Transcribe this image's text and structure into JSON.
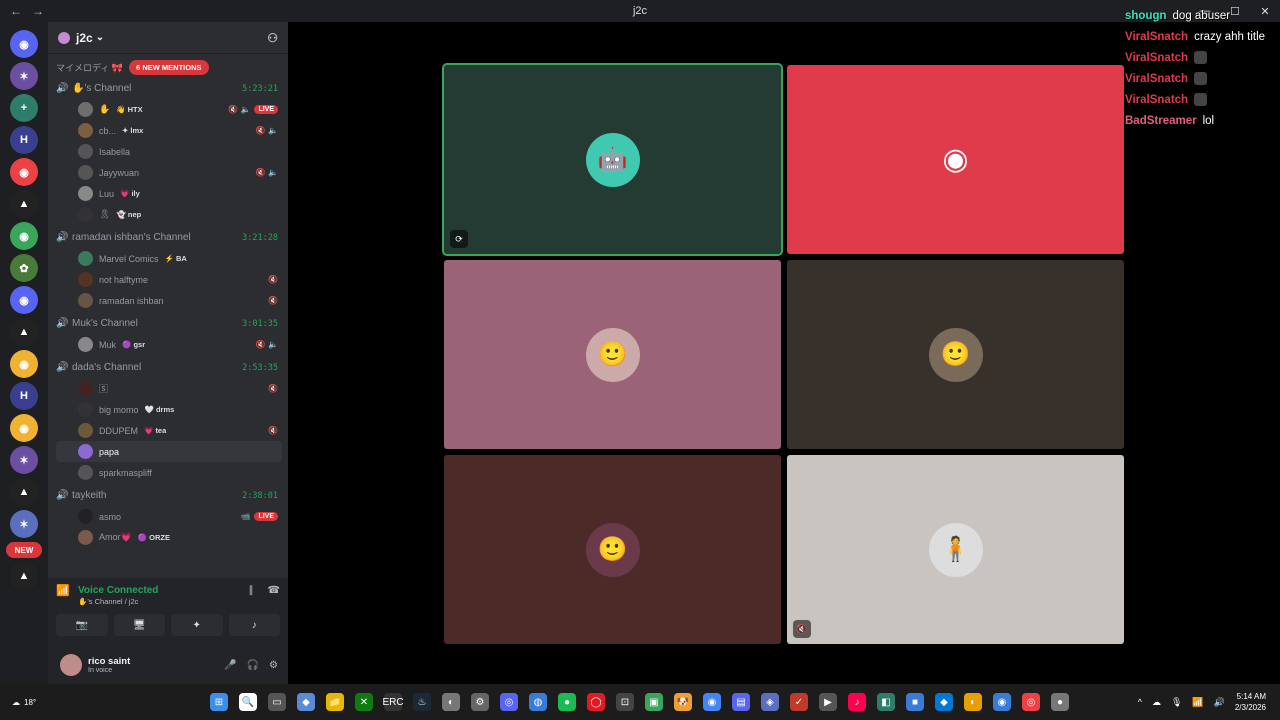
{
  "titlebar": {
    "title": "j2c",
    "back": "←",
    "forward": "→",
    "minimize": "—",
    "maximize": "☐",
    "close": "✕"
  },
  "servers": [
    {
      "label": "◉",
      "badge": "94",
      "color": "#5865f2"
    },
    {
      "label": "✶",
      "badge": "1",
      "color": "#6b4fa0"
    },
    {
      "label": "+",
      "badge": "2",
      "color": "#2e7d6b"
    },
    {
      "label": "H",
      "badge": "1",
      "color": "#3b3f8f"
    },
    {
      "label": "◉",
      "badge": "1",
      "color": "#ed4245"
    },
    {
      "label": "▲",
      "badge": "2",
      "color": "#222"
    },
    {
      "label": "◉",
      "badge": "1",
      "color": "#3ba55c"
    },
    {
      "label": "✿",
      "badge": "1",
      "color": "#4a7a3a"
    },
    {
      "label": "◉",
      "badge": "3",
      "color": "#5865f2"
    },
    {
      "label": "▲",
      "badge": "1",
      "color": "#222"
    },
    {
      "label": "◉",
      "badge": "1",
      "color": "#f0b232"
    },
    {
      "label": "H",
      "badge": "1",
      "color": "#3b3f8f"
    },
    {
      "label": "◉",
      "badge": "1",
      "color": "#f0b232"
    },
    {
      "label": "✶",
      "badge": "1",
      "color": "#6b4fa0"
    },
    {
      "label": "▲",
      "badge": "1",
      "color": "#222"
    },
    {
      "label": "✶",
      "badge": "1",
      "color": "#5b6fbf"
    },
    {
      "label": "▲",
      "badge": "",
      "color": "#222"
    }
  ],
  "new_label": "NEW",
  "guild": {
    "name": "j2c",
    "chevron": "⌄",
    "add_user": "⚇"
  },
  "category": {
    "name": "マイメロディ 🎀",
    "mentions": "6 NEW MENTIONS"
  },
  "channels": [
    {
      "name": "✋'s Channel",
      "time": "5:23:21",
      "users": [
        {
          "name": "✋",
          "tag": "👋 HTX",
          "icons": "🔇 🔈",
          "live": "LIVE",
          "color": "#6e6e6e"
        },
        {
          "name": "cb...",
          "tag": "✦ lmx",
          "icons": "🔇 🔈",
          "live": "",
          "color": "#7a6040"
        },
        {
          "name": "Isabella",
          "tag": "",
          "icons": "",
          "live": "",
          "color": "#555"
        },
        {
          "name": "Jayywuan",
          "tag": "",
          "icons": "🔇 🔈",
          "live": "",
          "color": "#555"
        },
        {
          "name": "Luu",
          "tag": "💗 ily",
          "icons": "",
          "live": "",
          "color": "#888"
        },
        {
          "name": "🎗",
          "tag": "👻 nep",
          "icons": "",
          "live": "",
          "color": "#333"
        }
      ]
    },
    {
      "name": "ramadan ishban's Channel",
      "time": "3:21:28",
      "users": [
        {
          "name": "Marvel Comics",
          "tag": "⚡ BA",
          "icons": "",
          "live": "",
          "color": "#3b7a5a"
        },
        {
          "name": "not halftyme",
          "tag": "",
          "icons": "🔇",
          "live": "",
          "color": "#553322"
        },
        {
          "name": "ramadan ishban",
          "tag": "",
          "icons": "🔇",
          "live": "",
          "color": "#665544"
        }
      ]
    },
    {
      "name": "Muk's Channel",
      "time": "3:01:35",
      "users": [
        {
          "name": "Muk",
          "tag": "🟣 gsr",
          "icons": "🔇 🔈",
          "live": "",
          "color": "#888"
        }
      ]
    },
    {
      "name": "dada's Channel",
      "time": "2:53:35",
      "users": [
        {
          "name": "🅂",
          "tag": "",
          "icons": "🔇",
          "live": "",
          "color": "#442222"
        },
        {
          "name": "big momo",
          "tag": "🤍 drms",
          "icons": "",
          "live": "",
          "color": "#333"
        },
        {
          "name": "DDUPEM",
          "tag": "💗 tea",
          "icons": "🔇",
          "live": "",
          "color": "#6a5a3a"
        },
        {
          "name": "papa",
          "tag": "",
          "icons": "",
          "live": "",
          "color": "#8b6bd1"
        },
        {
          "name": "sparkmaspliff",
          "tag": "",
          "icons": "",
          "live": "",
          "color": "#555"
        }
      ]
    },
    {
      "name": "taykeith",
      "time": "2:38:01",
      "users": [
        {
          "name": "asmo",
          "tag": "",
          "icons": "📹",
          "live": "LIVE",
          "color": "#222"
        },
        {
          "name": "Amor💗",
          "tag": "🟣 ORZE",
          "icons": "",
          "live": "",
          "color": "#7a5a4a"
        }
      ]
    }
  ],
  "voice": {
    "status": "Voice Connected",
    "channel": "✋'s Channel / j2c",
    "btn_cam": "📷",
    "btn_share": "🖥",
    "btn_activity": "✦",
    "btn_sound": "♪"
  },
  "me": {
    "name": "rico saint",
    "status": "In voice",
    "mic": "🎤",
    "headset": "🎧",
    "settings": "⚙"
  },
  "tiles": [
    {
      "bg": "#243b33",
      "pic_bg": "#3ec9b0",
      "glyph": "🤖",
      "corner": "⟳",
      "speaking": true
    },
    {
      "bg": "#e03b4b",
      "pic_bg": "transparent",
      "glyph": "◉",
      "corner": "",
      "speaking": false
    },
    {
      "bg": "#9a6377",
      "pic_bg": "#caa",
      "glyph": "🙂",
      "corner": "",
      "speaking": false
    },
    {
      "bg": "#38302b",
      "pic_bg": "#7a6a5a",
      "glyph": "🙂",
      "corner": "",
      "speaking": false
    },
    {
      "bg": "#4b2a27",
      "pic_bg": "#6a3a4a",
      "glyph": "🙂",
      "corner": "",
      "speaking": false
    },
    {
      "bg": "#c9c4c0",
      "pic_bg": "#ddd",
      "glyph": "🧍",
      "corner": "🔇",
      "speaking": false
    }
  ],
  "chat": [
    {
      "user": "shougn",
      "msg": "dog abuser",
      "color": "#3ee0c0",
      "emote": false
    },
    {
      "user": "ViralSnatch",
      "msg": "crazy ahh title",
      "color": "#e03b4b",
      "emote": false
    },
    {
      "user": "ViralSnatch",
      "msg": "",
      "color": "#e03b4b",
      "emote": true
    },
    {
      "user": "ViralSnatch",
      "msg": "",
      "color": "#e03b4b",
      "emote": true
    },
    {
      "user": "ViralSnatch",
      "msg": "",
      "color": "#e03b4b",
      "emote": true
    },
    {
      "user": "BadStreamer",
      "msg": "lol",
      "color": "#e06080",
      "emote": false
    }
  ],
  "taskbar": {
    "temp": "18°",
    "apps": [
      "⊞",
      "🔍",
      "▭",
      "◆",
      "📁",
      "✕",
      "ERC",
      "♨",
      "◐",
      "⚙",
      "◎",
      "◍",
      "●",
      "◯",
      "⊡",
      "▣",
      "🐶",
      "◉",
      "▤",
      "◈",
      "✓",
      "▶",
      "♪",
      "◧",
      "■",
      "◆",
      "◐",
      "◉",
      "◎",
      "●"
    ],
    "app_colors": [
      "#3b8eea",
      "#fff",
      "#555",
      "#5a8bd6",
      "#e6b800",
      "#107c10",
      "#333",
      "#1b2838",
      "#777",
      "#666",
      "#5865f2",
      "#3a7bd5",
      "#1db954",
      "#e01b24",
      "#444",
      "#3ba55c",
      "#f0a030",
      "#4285f4",
      "#5865f2",
      "#5b6fbf",
      "#c0392b",
      "#555",
      "#ff0050",
      "#2e7d6b",
      "#3a7bd5",
      "#0078d4",
      "#e6a000",
      "#3a7bd5",
      "#ed4245",
      "#777"
    ],
    "time": "5:14 AM",
    "date": "2/3/2026",
    "tray": [
      "^",
      "☁",
      "🎙",
      "📶",
      "🔊"
    ]
  }
}
